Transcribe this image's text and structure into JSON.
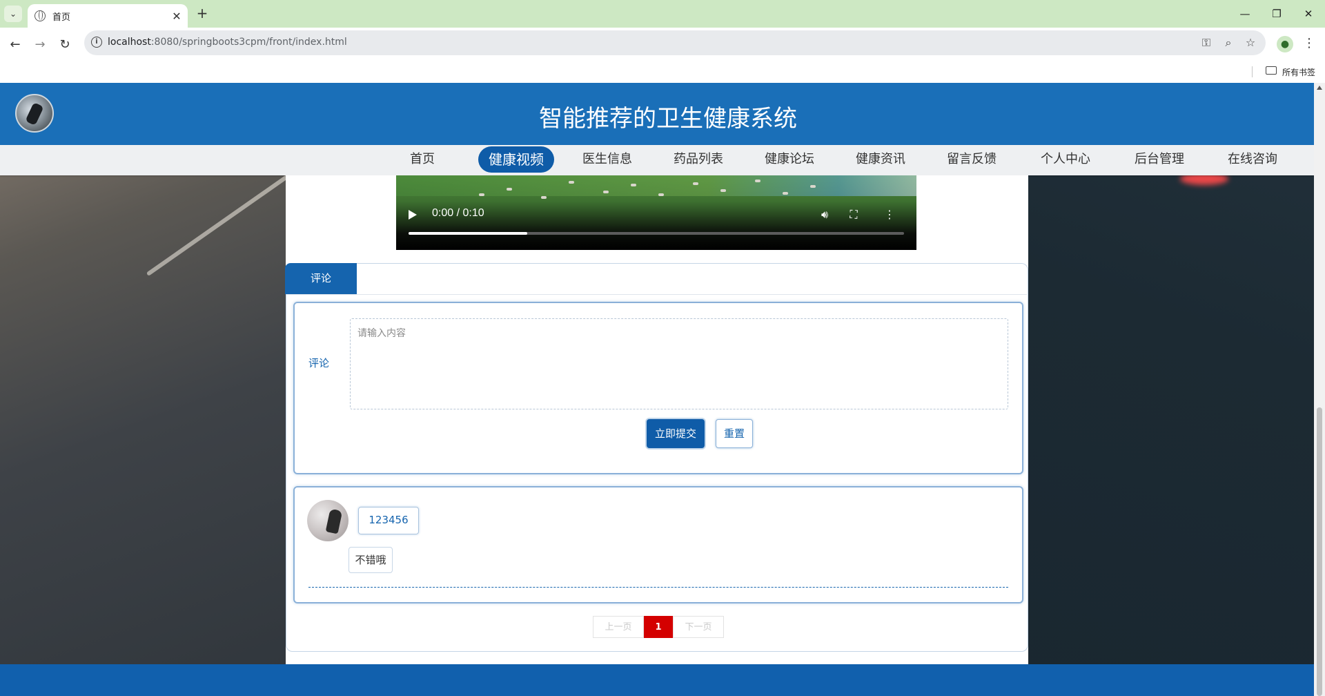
{
  "browser": {
    "tab_title": "首页",
    "url_host": "localhost",
    "url_rest": ":8080/springboots3cpm/front/index.html",
    "bookmark_folder": "所有书签"
  },
  "site": {
    "title": "智能推荐的卫生健康系统",
    "nav": [
      "首页",
      "健康视频",
      "医生信息",
      "药品列表",
      "健康论坛",
      "健康资讯",
      "留言反馈",
      "个人中心",
      "后台管理",
      "在线咨询"
    ],
    "active_nav": "健康视频"
  },
  "video": {
    "time": "0:00 / 0:10",
    "progress": 0.24
  },
  "comments_panel": {
    "tab_label": "评论",
    "form": {
      "label": "评论",
      "placeholder": "请输入内容",
      "submit_label": "立即提交",
      "reset_label": "重置"
    },
    "items": [
      {
        "user": "123456",
        "text": "不错哦"
      }
    ]
  },
  "pagination": {
    "prev": "上一页",
    "current": "1",
    "next": "下一页"
  },
  "colors": {
    "header": "#1a6fb8",
    "primary": "#1564ae",
    "page_current": "#d40000"
  }
}
